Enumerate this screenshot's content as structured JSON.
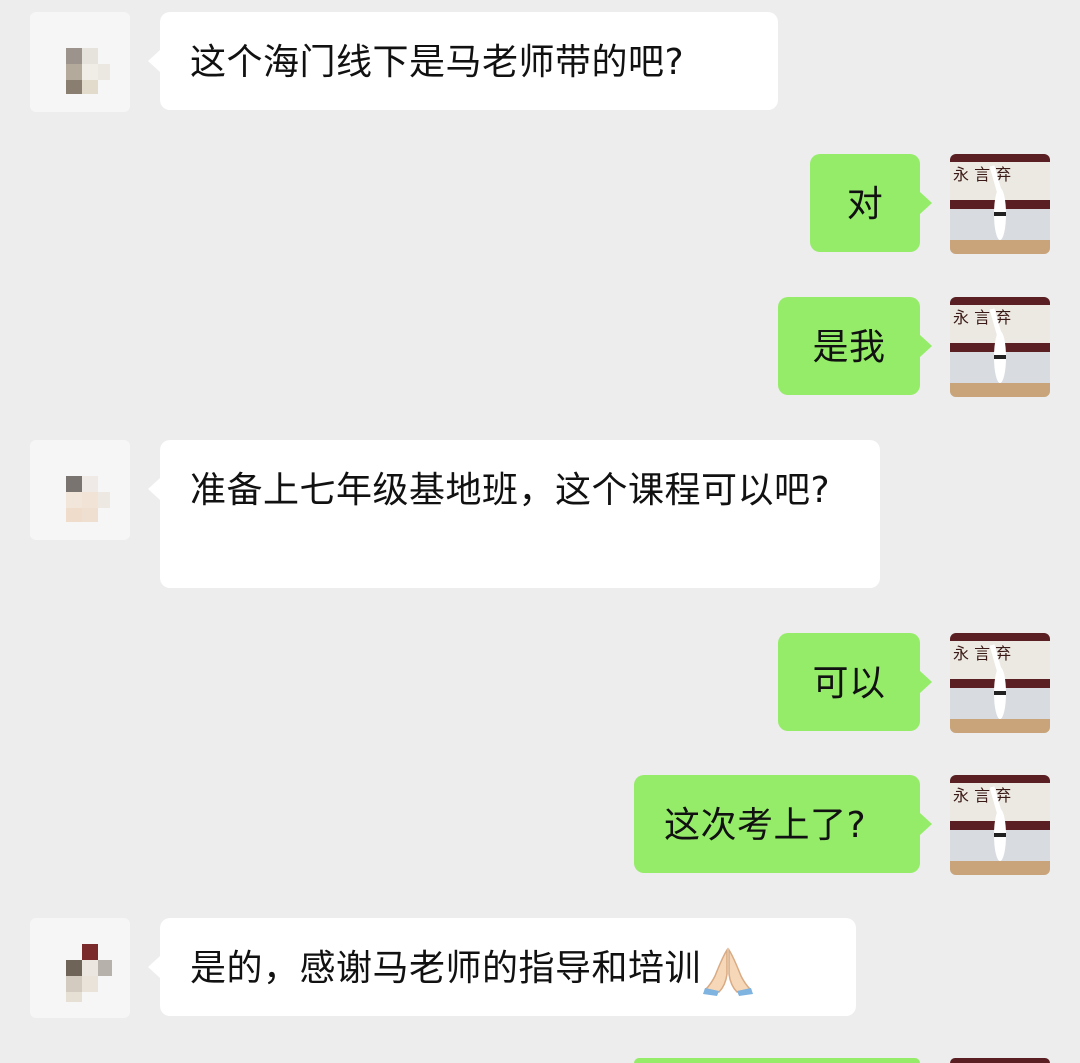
{
  "messages": [
    {
      "side": "in",
      "text": "这个海门线下是马老师带的吧?"
    },
    {
      "side": "out",
      "text": "对"
    },
    {
      "side": "out",
      "text": "是我"
    },
    {
      "side": "in",
      "text": "准备上七年级基地班，这个课程可以吧?"
    },
    {
      "side": "out",
      "text": "可以"
    },
    {
      "side": "out",
      "text": "这次考上了?"
    },
    {
      "side": "in",
      "text": "是的，感谢马老师的指导和培训",
      "emoji": "folded-hands-icon"
    }
  ],
  "colors": {
    "background": "#ededed",
    "bubble_in": "#ffffff",
    "bubble_out": "#95ec69",
    "text": "#111111"
  },
  "avatar_right": {
    "sign_text": "永  言  弃"
  }
}
